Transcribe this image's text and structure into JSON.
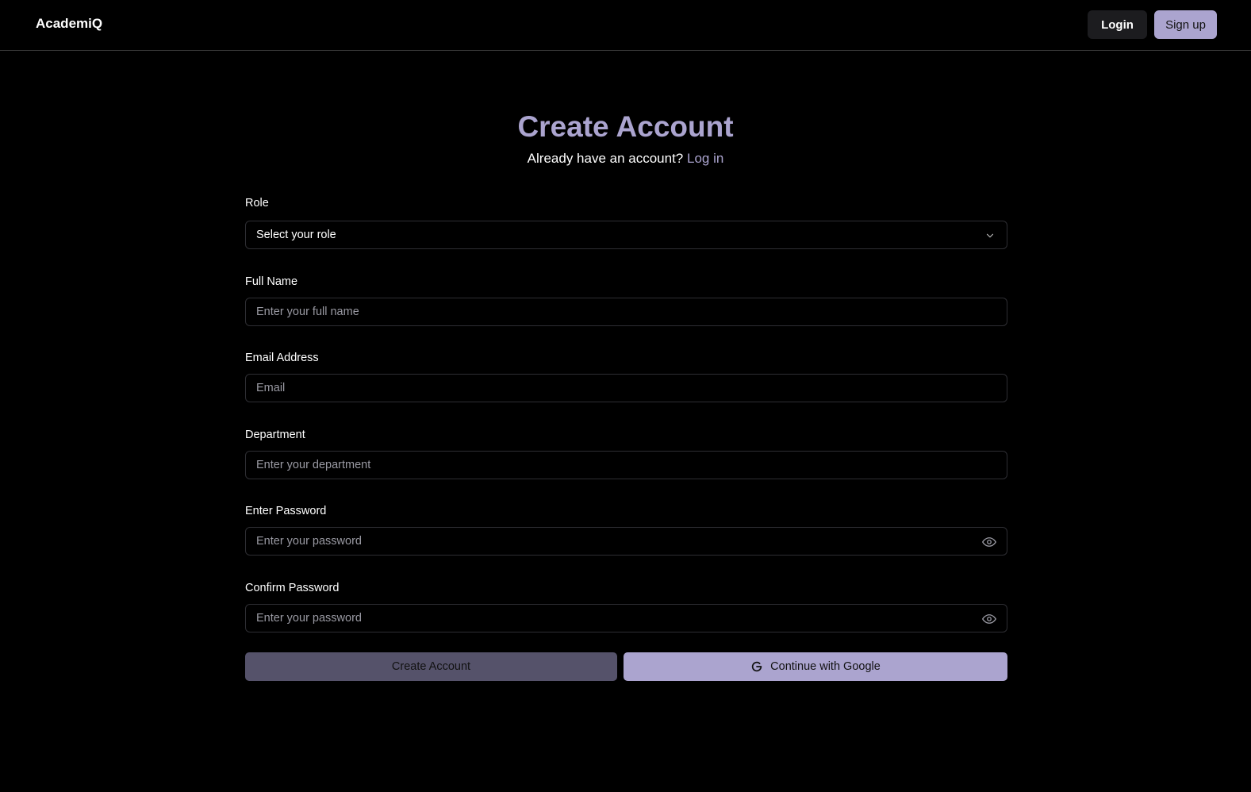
{
  "navbar": {
    "brand": "AcademiQ",
    "login_label": "Login",
    "signup_label": "Sign up"
  },
  "header": {
    "title": "Create Account",
    "subtitle_text": "Already have an account?",
    "subtitle_link": "Log in"
  },
  "form": {
    "role": {
      "label": "Role",
      "selected": "Select your role",
      "icon": "chevron-down-icon"
    },
    "full_name": {
      "label": "Full Name",
      "placeholder": "Enter your full name",
      "value": ""
    },
    "email": {
      "label": "Email Address",
      "placeholder": "Email",
      "value": ""
    },
    "department": {
      "label": "Department",
      "placeholder": "Enter your department",
      "value": ""
    },
    "password": {
      "label": "Enter Password",
      "placeholder": "Enter your password",
      "value": "",
      "icon": "eye-icon"
    },
    "confirm_password": {
      "label": "Confirm Password",
      "placeholder": "Enter your password",
      "value": "",
      "icon": "eye-icon"
    }
  },
  "actions": {
    "create_label": "Create Account",
    "google_label": "Continue with Google",
    "google_icon": "google-icon"
  },
  "colors": {
    "background": "#000000",
    "accent": "#aba4cf",
    "muted_button": "#55526a",
    "dark_button": "#1c1c1f",
    "border": "#2e2e33"
  }
}
